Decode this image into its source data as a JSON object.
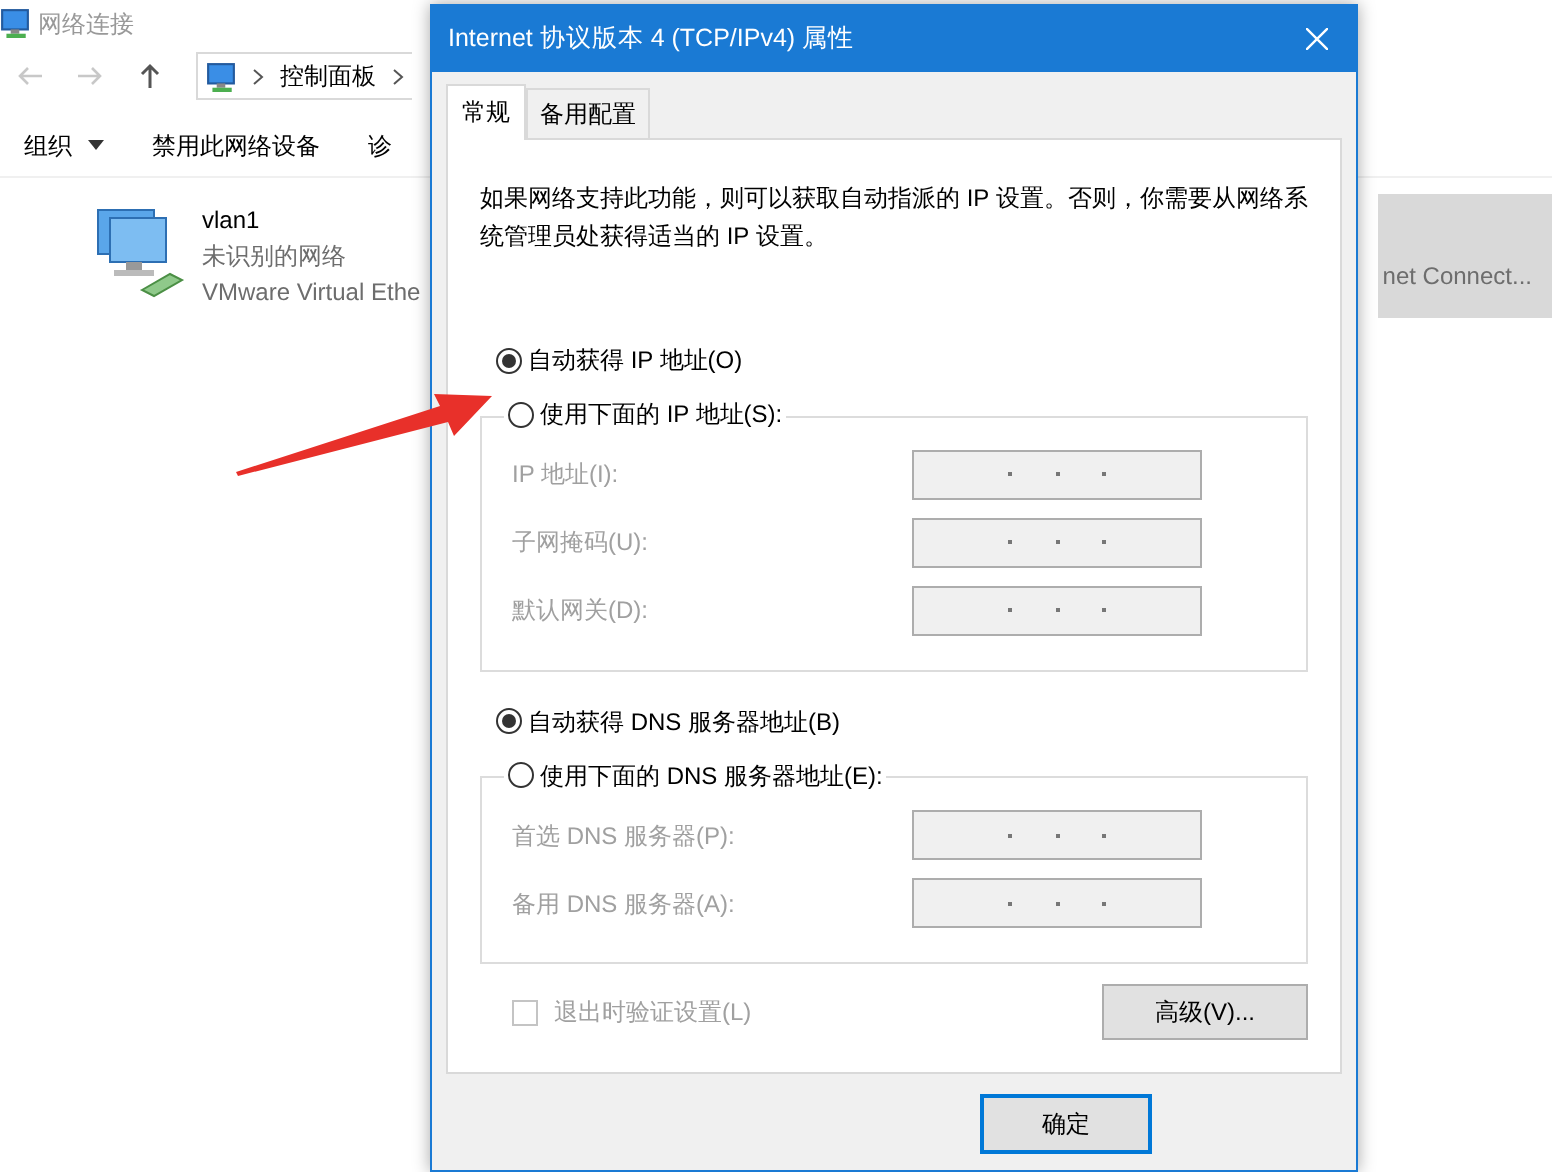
{
  "explorer": {
    "title": "网络连接",
    "address_path": [
      {
        "label": "控制面板"
      }
    ],
    "toolbar": [
      {
        "label": "组织",
        "dropdown": true
      },
      {
        "label": "禁用此网络设备",
        "dropdown": false
      },
      {
        "label": "诊",
        "dropdown": false
      }
    ],
    "adapters": [
      {
        "name": "vlan1",
        "status": "未识别的网络",
        "device": "VMware Virtual Ethe",
        "selected": false
      },
      {
        "device": "net Connect...",
        "selected": true
      }
    ]
  },
  "dialog": {
    "title": "Internet 协议版本 4 (TCP/IPv4) 属性",
    "tabs": [
      {
        "label": "常规",
        "selected": true
      },
      {
        "label": "备用配置",
        "selected": false
      }
    ],
    "description": "如果网络支持此功能，则可以获取自动指派的 IP 设置。否则，你需要从网络系统管理员处获得适当的 IP 设置。",
    "ip_options": [
      {
        "label": "自动获得 IP 地址(O)",
        "selected": true
      },
      {
        "label": "使用下面的 IP 地址(S):",
        "selected": false
      }
    ],
    "ip_fields": [
      {
        "label": "IP 地址(I):",
        "disabled": true
      },
      {
        "label": "子网掩码(U):",
        "disabled": true
      },
      {
        "label": "默认网关(D):",
        "disabled": true
      }
    ],
    "dns_options": [
      {
        "label": "自动获得 DNS 服务器地址(B)",
        "selected": true
      },
      {
        "label": "使用下面的 DNS 服务器地址(E):",
        "selected": false
      }
    ],
    "dns_fields": [
      {
        "label": "首选 DNS 服务器(P):",
        "disabled": true
      },
      {
        "label": "备用 DNS 服务器(A):",
        "disabled": true
      }
    ],
    "validate_on_exit": {
      "label": "退出时验证设置(L)",
      "checked": false,
      "disabled": true
    },
    "advanced_button": "高级(V)...",
    "ok_button": "确定"
  }
}
